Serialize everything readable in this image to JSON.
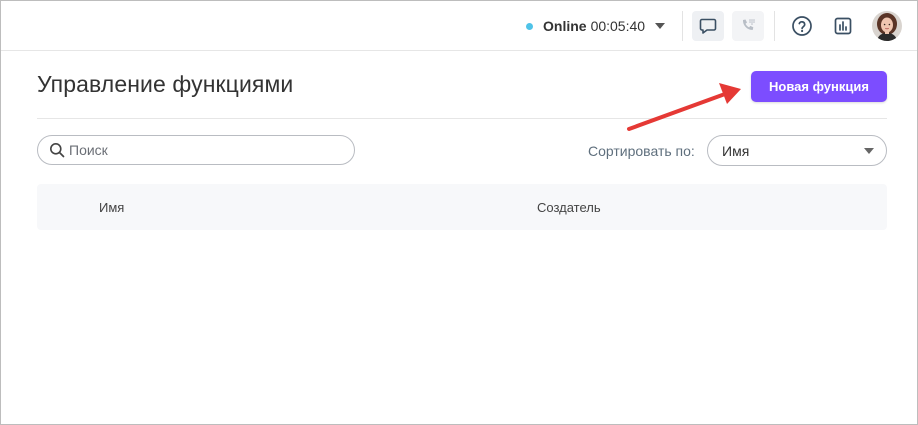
{
  "header": {
    "status_label": "Online",
    "status_time": "00:05:40",
    "status_color": "#4fc3e8",
    "icons": [
      "chat-icon",
      "phone-icon",
      "help-icon",
      "report-icon",
      "avatar"
    ]
  },
  "page": {
    "title": "Управление функциями",
    "new_button_label": "Новая функция",
    "accent_color": "#7c4dff"
  },
  "search": {
    "placeholder": "Поиск",
    "value": ""
  },
  "sort": {
    "label": "Сортировать по:",
    "selected": "Имя"
  },
  "table": {
    "columns": [
      "Имя",
      "Создатель"
    ],
    "rows": []
  }
}
